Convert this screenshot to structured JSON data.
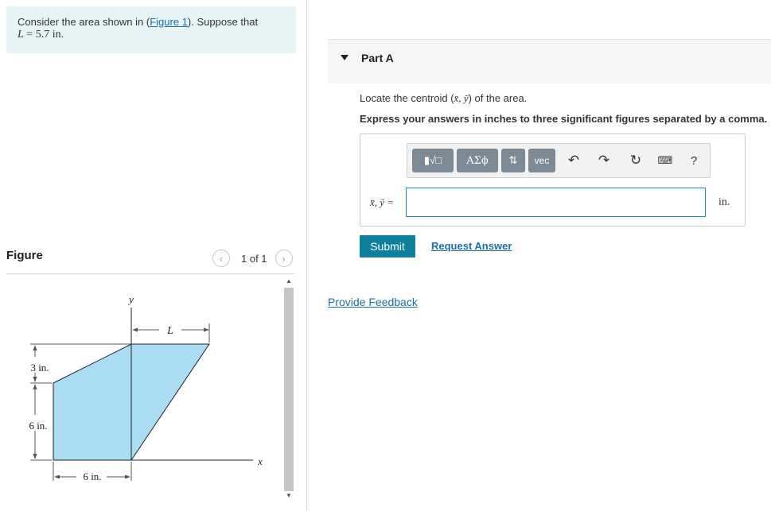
{
  "problem": {
    "text_before": "Consider the area shown in (",
    "figure_link": "Figure 1",
    "text_after": "). Suppose that",
    "var": "L",
    "value_text": " = 5.7 in."
  },
  "figure_panel": {
    "title": "Figure",
    "pager_text": "1 of 1",
    "prev_icon": "chevron-left-icon",
    "next_icon": "chevron-right-icon"
  },
  "figure": {
    "y_axis": "y",
    "x_axis": "x",
    "L_label": "L",
    "dim_3in": "3 in.",
    "dim_6in_vertical": "6 in.",
    "dim_6in_horizontal": "6 in.",
    "fill_color": "#aadcf3"
  },
  "part": {
    "label": "Part A",
    "prompt_before": "Locate the centroid (",
    "prompt_vars": "x̄, ȳ",
    "prompt_after": ") of the area.",
    "instruction": "Express your answers in inches to three significant figures separated by a comma."
  },
  "toolbar": {
    "template_label": "▮√□",
    "greek_label": "ΑΣϕ",
    "updown_label": "⇅",
    "vec_label": "vec",
    "undo_icon": "undo-icon",
    "redo_icon": "redo-icon",
    "reset_icon": "reset-icon",
    "keyboard_icon": "keyboard-icon",
    "help_label": "?"
  },
  "answer": {
    "equation_label": "x̄, ȳ =",
    "value": "",
    "unit": "in."
  },
  "actions": {
    "submit": "Submit",
    "request_answer": "Request Answer",
    "feedback": "Provide Feedback"
  },
  "colors": {
    "accent": "#0f7f9e",
    "link": "#1a6fa8",
    "problem_bg": "#e6f4f5"
  }
}
